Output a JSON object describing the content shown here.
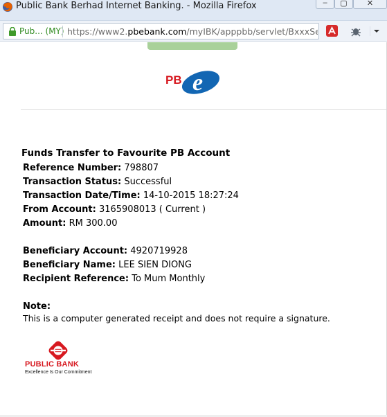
{
  "window": {
    "title": "Public Bank Berhad Internet Banking. - Mozilla Firefox",
    "minimize_glyph": "–",
    "maximize_glyph": "▢",
    "close_glyph": "✕"
  },
  "navbar": {
    "identity_label": "Pub... (MY)",
    "url_prefix": "https://www2.",
    "url_domain": "pbebank.com",
    "url_suffix": "/myIBK/apppbb/servlet/BxxxServlet?JSID",
    "icons": [
      "lock-icon",
      "avira-icon",
      "bug-icon",
      "menu-dropdown-icon"
    ]
  },
  "brand": {
    "logo_text_pb": "PB",
    "logo_text_e": "e",
    "pb_red": "#d71920",
    "pbe_blue": "#1266b3",
    "bank_name": "PUBLIC BANK",
    "tagline": "Excellence Is Our Commitment"
  },
  "receipt": {
    "title": "Funds Transfer to Favourite PB Account",
    "fields": [
      {
        "label": "Reference Number:",
        "value": "798807"
      },
      {
        "label": "Transaction Status:",
        "value": "Successful"
      },
      {
        "label": "Transaction Date/Time:",
        "value": "14-10-2015 18:27:24"
      },
      {
        "label": "From Account:",
        "value": "3165908013 ( Current )"
      },
      {
        "label": "Amount:",
        "value": "RM 300.00"
      }
    ],
    "beneficiary": [
      {
        "label": "Beneficiary Account:",
        "value": "4920719928"
      },
      {
        "label": "Beneficiary Name:",
        "value": "LEE SIEN DIONG"
      },
      {
        "label": "Recipient Reference:",
        "value": "To Mum Monthly"
      }
    ],
    "note_title": "Note:",
    "note_text": "This is a computer generated receipt and does not require a signature."
  }
}
